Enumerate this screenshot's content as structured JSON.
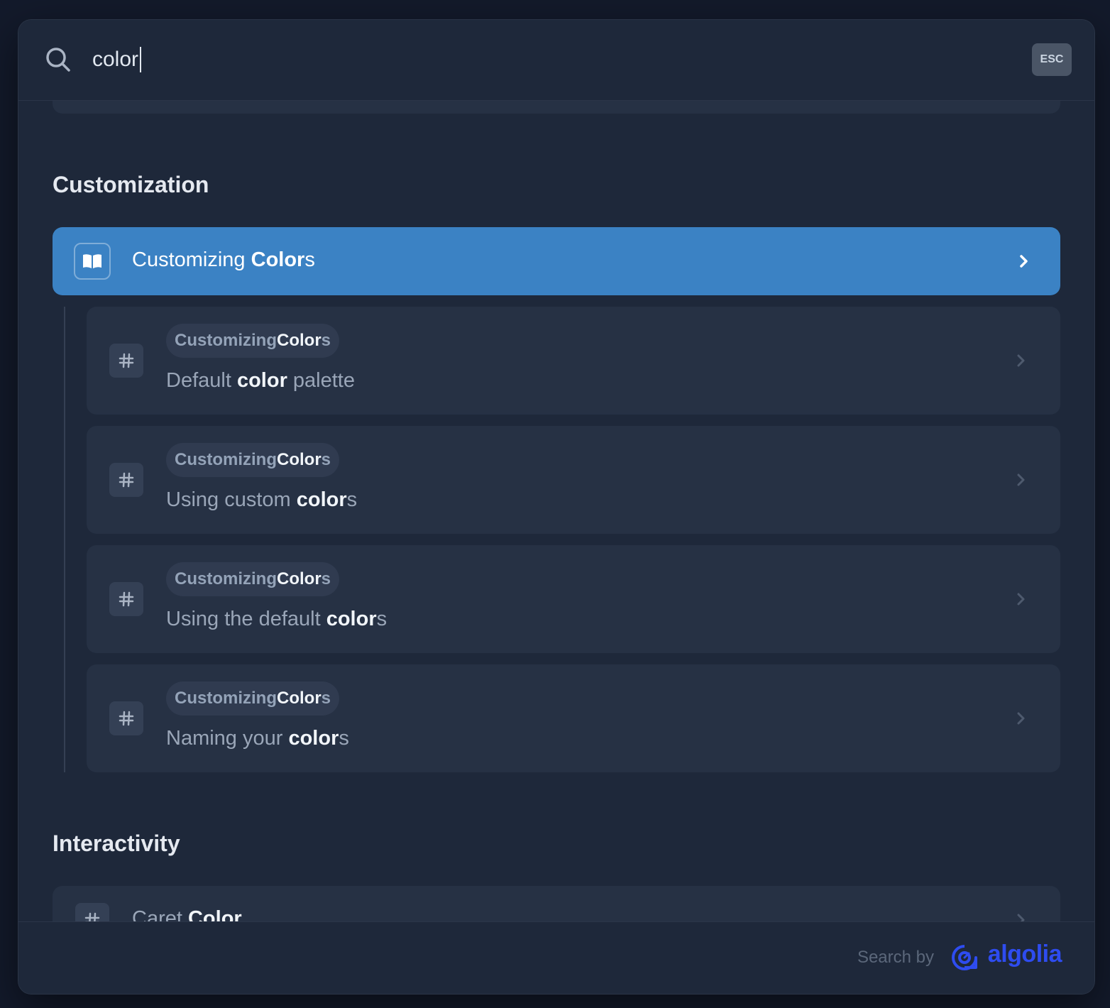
{
  "search": {
    "value": "color",
    "esc_label": "ESC"
  },
  "sections": [
    {
      "title": "Customization"
    },
    {
      "title": "Interactivity"
    }
  ],
  "active_hit": {
    "title_plain": "Customizing ",
    "title_match": "Color",
    "title_rest": "s"
  },
  "hits": [
    {
      "crumb_plain": "Customizing ",
      "crumb_match": "Color",
      "crumb_rest": "s",
      "pre": "Default ",
      "match": "color",
      "post": " palette"
    },
    {
      "crumb_plain": "Customizing ",
      "crumb_match": "Color",
      "crumb_rest": "s",
      "pre": "Using custom ",
      "match": "color",
      "post": "s"
    },
    {
      "crumb_plain": "Customizing ",
      "crumb_match": "Color",
      "crumb_rest": "s",
      "pre": "Using the default ",
      "match": "color",
      "post": "s"
    },
    {
      "crumb_plain": "Customizing ",
      "crumb_match": "Color",
      "crumb_rest": "s",
      "pre": "Naming your ",
      "match": "color",
      "post": "s"
    }
  ],
  "partial_hit": {
    "pre": "Caret ",
    "match": "Color"
  },
  "footer": {
    "search_by": "Search by",
    "brand": "algolia"
  },
  "colors": {
    "accent": "#3b82c4",
    "brand": "#2e4cf0",
    "background": "#1e283a"
  }
}
